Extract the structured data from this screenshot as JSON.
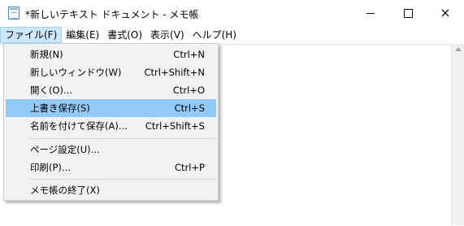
{
  "window": {
    "title": "*新しいテキスト ドキュメント - メモ帳",
    "app_icon": "notepad-icon",
    "buttons": {
      "minimize": "minimize-icon",
      "maximize": "maximize-icon",
      "close": "×"
    }
  },
  "menubar": {
    "items": [
      "ファイル(F)",
      "編集(E)",
      "書式(O)",
      "表示(V)",
      "ヘルプ(H)"
    ],
    "active_index": 0
  },
  "file_menu": {
    "highlighted_index": 3,
    "items": [
      {
        "label": "新規(N)",
        "shortcut": "Ctrl+N"
      },
      {
        "label": "新しいウィンドウ(W)",
        "shortcut": "Ctrl+Shift+N"
      },
      {
        "label": "開く(O)...",
        "shortcut": "Ctrl+O"
      },
      {
        "label": "上書き保存(S)",
        "shortcut": "Ctrl+S"
      },
      {
        "label": "名前を付けて保存(A)...",
        "shortcut": "Ctrl+Shift+S"
      },
      {
        "label": "ページ設定(U)...",
        "shortcut": ""
      },
      {
        "label": "印刷(P)...",
        "shortcut": "Ctrl+P"
      },
      {
        "label": "メモ帳の終了(X)",
        "shortcut": ""
      }
    ]
  },
  "colors": {
    "highlight": "#91c9f7",
    "menu_active_bg": "#cce8ff",
    "menu_bg": "#f2f2f2"
  }
}
